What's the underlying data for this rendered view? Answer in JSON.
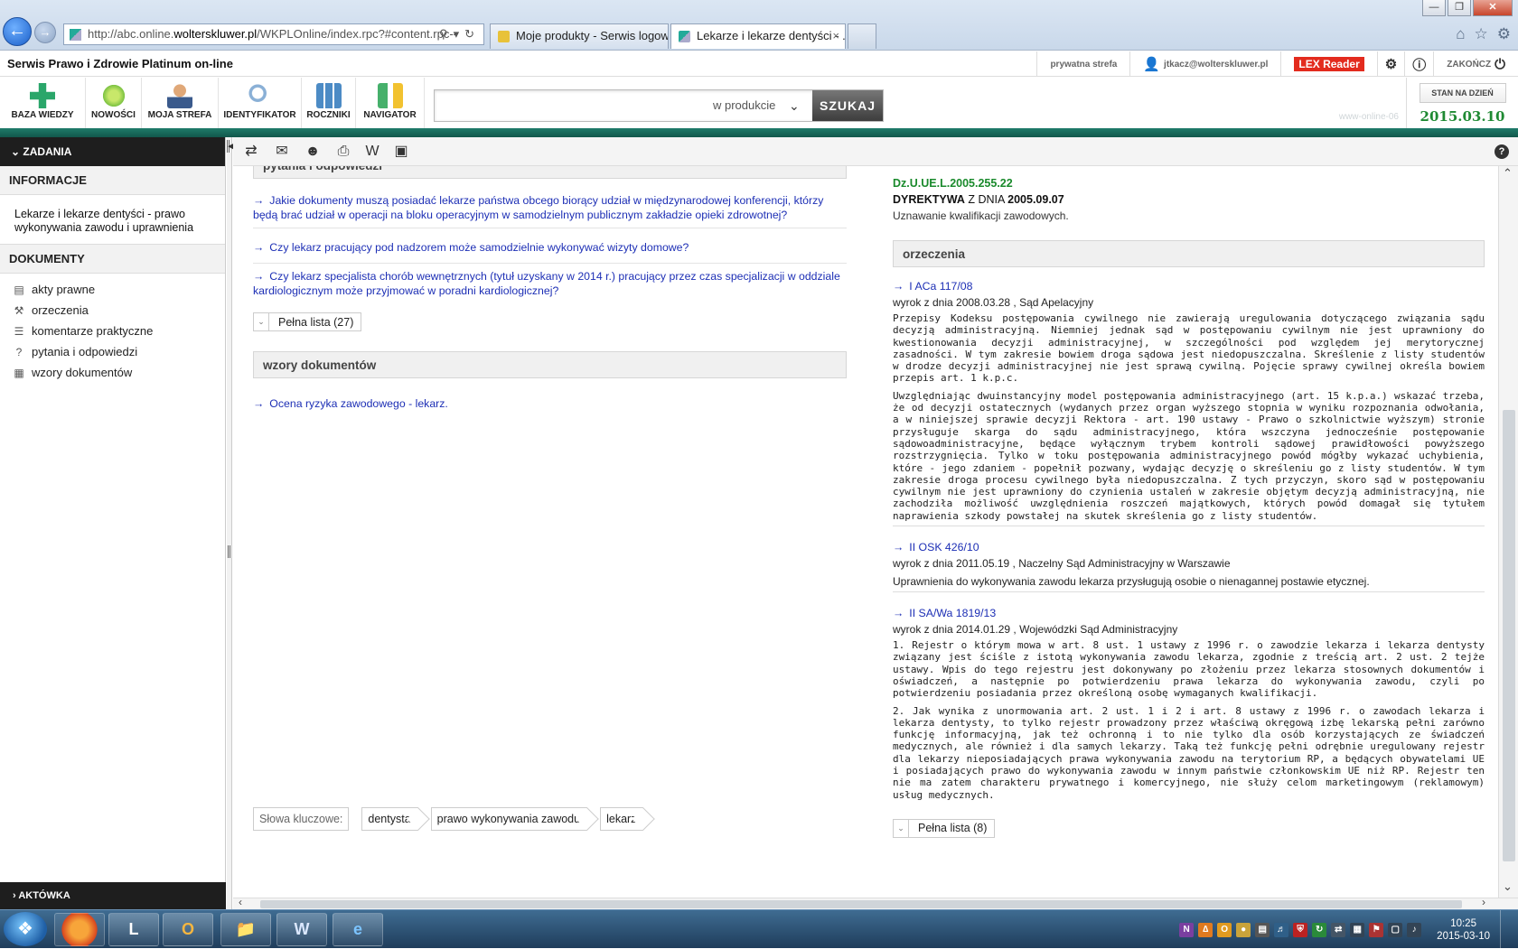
{
  "browser": {
    "address": "http://abc.online.",
    "address_bold": "wolterskluwer.pl",
    "address_rest": "/WKPLOnline/index.rpc?#content.rpc--",
    "tabs": [
      {
        "label": "Moje produkty - Serwis logow..."
      },
      {
        "label": "Lekarze i lekarze dentyści - ...",
        "close": "×"
      }
    ],
    "window_controls": [
      "—",
      "❐",
      "✕"
    ],
    "icons": [
      "home-icon",
      "star-icon",
      "gear-icon"
    ]
  },
  "app": {
    "title": "Serwis Prawo i Zdrowie Platinum on-line",
    "top_right": {
      "private_zone": "prywatna strefa",
      "user_email": "jtkacz@wolterskluwer.pl",
      "lex_reader": "LEX Reader",
      "end": "ZAKOŃCZ"
    },
    "tools": [
      {
        "label": "BAZA WIEDZY",
        "color": "#2aa66a"
      },
      {
        "label": "NOWOŚCI",
        "color": "#7cc242"
      },
      {
        "label": "MOJA STREFA",
        "color": "#b4673a"
      },
      {
        "label": "IDENTYFIKATOR",
        "color": "#8ab0d6"
      },
      {
        "label": "ROCZNIKI",
        "color": "#4c8bc5"
      },
      {
        "label": "NAVIGATOR",
        "color": "#46b06b"
      }
    ],
    "search": {
      "placeholder": "",
      "scope": "w produkcie",
      "button": "SZUKAJ"
    },
    "date": {
      "button": "STAN NA DZIEŃ",
      "value": "2015.03.10"
    },
    "server_watermark": "www-online-06"
  },
  "sidebar": {
    "tasks": "ZADANIA",
    "info_header": "INFORMACJE",
    "info_text": "Lekarze i lekarze dentyści - prawo wykonywania zawodu i uprawnienia",
    "docs_header": "DOKUMENTY",
    "items": [
      {
        "label": "akty prawne",
        "icon": "document-icon"
      },
      {
        "label": "orzeczenia",
        "icon": "gavel-icon"
      },
      {
        "label": "komentarze praktyczne",
        "icon": "comment-icon"
      },
      {
        "label": "pytania i odpowiedzi",
        "icon": "question-icon"
      },
      {
        "label": "wzory dokumentów",
        "icon": "template-icon"
      }
    ],
    "briefcase": "AKTÓWKA"
  },
  "content": {
    "qa": {
      "header": "pytania i odpowiedzi",
      "items": [
        "Jakie dokumenty muszą posiadać lekarze państwa obcego biorący udział w międzynarodowej konferencji, którzy będą brać udział w operacji na bloku operacyjnym w samodzielnym publicznym zakładzie opieki zdrowotnej?",
        "Czy lekarz pracujący pod nadzorem może samodzielnie wykonywać wizyty domowe?",
        "Czy lekarz specjalista chorób wewnętrznych (tytuł uzyskany w 2014 r.) pracujący przez czas specjalizacji w oddziale kardiologicznym może przyjmować w poradni kardiologicznej?"
      ],
      "full_list": "Pełna lista (27)"
    },
    "templates": {
      "header": "wzory dokumentów",
      "items": [
        "Ocena ryzyka zawodowego - lekarz."
      ]
    },
    "keywords": {
      "label": "Słowa kluczowe:",
      "items": [
        "dentysta",
        "prawo wykonywania zawodu",
        "lekarz"
      ]
    },
    "directive": {
      "ref": "Dz.U.UE.L.2005.255.22",
      "type": "DYREKTYWA",
      "z_dnia": "Z DNIA",
      "date": "2005.09.07",
      "desc": "Uznawanie kwalifikacji zawodowych."
    },
    "judgments": {
      "header": "orzeczenia",
      "items": [
        {
          "sig": "I ACa 117/08",
          "sub": "wyrok z dnia 2008.03.28 , Sąd Apelacyjny",
          "texts": [
            "Przepisy Kodeksu postępowania cywilnego nie zawierają uregulowania dotyczącego związania sądu decyzją administracyjną. Niemniej jednak sąd w postępowaniu cywilnym nie jest uprawniony do kwestionowania decyzji administracyjnej, w szczególności pod względem jej merytorycznej zasadności. W tym zakresie bowiem droga sądowa jest niedopuszczalna. Skreślenie z listy studentów w drodze decyzji administracyjnej nie jest sprawą cywilną. Pojęcie sprawy cywilnej określa bowiem przepis art. 1 k.p.c.",
            "Uwzględniając dwuinstancyjny model postępowania administracyjnego (art. 15 k.p.a.) wskazać trzeba, że od decyzji ostatecznych (wydanych przez organ wyższego stopnia w wyniku rozpoznania odwołania, a w niniejszej sprawie decyzji Rektora - art. 190 ustawy - Prawo o szkolnictwie wyższym) stronie przysługuje skarga do sądu administracyjnego, która wszczyna jednocześnie postępowanie sądowoadministracyjne, będące wyłącznym trybem kontroli sądowej prawidłowości powyższego rozstrzygnięcia. Tylko w toku postępowania administracyjnego powód mógłby wykazać uchybienia, które - jego zdaniem - popełnił pozwany, wydając decyzję o skreśleniu go z listy studentów. W tym zakresie droga procesu cywilnego była niedopuszczalna. Z tych przyczyn, skoro sąd w postępowaniu cywilnym nie jest uprawniony do czynienia ustaleń w zakresie objętym decyzją administracyjną, nie zachodziła możliwość uwzględnienia roszczeń majątkowych, których powód domagał się tytułem naprawienia szkody powstałej na skutek skreślenia go z listy studentów."
          ]
        },
        {
          "sig": "II OSK 426/10",
          "sub": "wyrok z dnia 2011.05.19 , Naczelny Sąd Administracyjny w Warszawie",
          "texts": [
            "Uprawnienia do wykonywania zawodu lekarza przysługują osobie o nienagannej postawie etycznej."
          ]
        },
        {
          "sig": "II SA/Wa 1819/13",
          "sub": "wyrok z dnia 2014.01.29 , Wojewódzki Sąd Administracyjny",
          "texts": [
            "1. Rejestr o którym mowa w art. 8 ust. 1 ustawy z 1996 r. o zawodzie lekarza i lekarza dentysty związany jest ściśle z istotą wykonywania zawodu lekarza, zgodnie z treścią art. 2 ust. 2 tejże ustawy. Wpis do tego rejestru jest dokonywany po złożeniu przez lekarza stosownych dokumentów i oświadczeń, a następnie po potwierdzeniu prawa lekarza do wykonywania zawodu, czyli po potwierdzeniu posiadania przez określoną osobę wymaganych kwalifikacji.",
            "2. Jak wynika z unormowania art. 2 ust. 1 i 2 i art. 8 ustawy z 1996 r. o zawodach lekarza i lekarza dentysty, to tylko rejestr prowadzony przez właściwą okręgową izbę lekarską pełni zarówno funkcję informacyjną, jak też ochronną i to nie tylko dla osób korzystających ze świadczeń medycznych, ale również i dla samych lekarzy. Taką też funkcję pełni odrębnie uregulowany rejestr dla lekarzy nieposiadających prawa wykonywania zawodu na terytorium RP, a będących obywatelami UE i posiadających prawo do wykonywania zawodu w innym państwie członkowskim UE niż RP. Rejestr ten nie ma zatem charakteru prywatnego i komercyjnego, nie służy celom marketingowym (reklamowym) usług medycznych."
          ]
        }
      ],
      "full_list": "Pełna lista (8)"
    }
  },
  "taskbar": {
    "apps": [
      "firefox-icon",
      "lex-icon",
      "outlook-icon",
      "explorer-icon",
      "word-icon",
      "ie-icon"
    ],
    "time": "10:25",
    "date": "2015-03-10"
  }
}
